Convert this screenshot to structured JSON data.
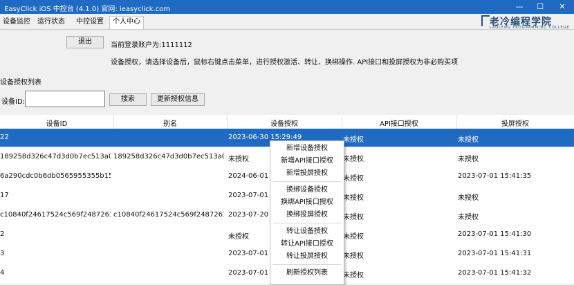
{
  "window": {
    "title": "EasyClick iOS 中控台  (4.1.0) 官网: ieasyclick.com",
    "minimize_label": "—",
    "maximize_label": "☐",
    "close_label": "✕"
  },
  "tabs": [
    "设备监控",
    "运行状态",
    "中控设置",
    "个人中心"
  ],
  "active_tab": "个人中心",
  "logo": {
    "text": "老冷编程学院",
    "subtitle": "LAOLENG PROGRAMMING COLLEGE"
  },
  "account": {
    "logout_label": "退出",
    "login_text": "当前登录账户为:1111112",
    "tip": "设备授权，请选择设备后，鼠标右键点击菜单，进行授权激活、转让、换绑操作. API接口和投屏授权为非必购买项"
  },
  "auth_list": {
    "section_label": "设备授权列表",
    "device_id_label": "设备ID:",
    "search_value": "",
    "search_button": "搜索",
    "refresh_button": "更新授权信息"
  },
  "table": {
    "columns": [
      "设备ID",
      "别名",
      "设备授权",
      "API接口授权",
      "投屏授权"
    ],
    "rows": [
      [
        "22",
        "",
        "2023-06-30 15:29:49",
        "未授权",
        "未授权"
      ],
      [
        "189258d326c47d3d0b7ec513a00...",
        "189258d326c47d3d0b7ec513a006...",
        "未授权",
        "未授权",
        "未授权"
      ],
      [
        "6a290cdc0b6db0565955355b157...",
        "",
        "2024-06-01 1",
        "未授权",
        "2023-07-01 15:41:35"
      ],
      [
        "17",
        "",
        "2023-07-01 1",
        "未授权",
        "未授权"
      ],
      [
        "c10840f24617524c569f2487261ab...",
        "c10840f24617524c569f2487261ab...",
        "2023-07-20 0",
        "未授权",
        "未授权"
      ],
      [
        "2",
        "",
        "未授权",
        "未授权",
        "2023-07-01 15:41:30"
      ],
      [
        "3",
        "",
        "2023-07-01 1",
        "未授权",
        "2023-07-01 15:41:31"
      ],
      [
        "4",
        "",
        "2023-07-01 1",
        "未授权",
        "2023-07-01 15:41:32"
      ]
    ],
    "selected_row": 0
  },
  "context_menu": [
    [
      "新增设备授权",
      "新增API接口授权",
      "新增投屏授权"
    ],
    [
      "换绑设备授权",
      "换绑API接口授权",
      "换绑投屏授权"
    ],
    [
      "转让设备授权",
      "转让API接口授权",
      "转让投屏授权"
    ],
    [
      "刷新授权列表"
    ]
  ]
}
